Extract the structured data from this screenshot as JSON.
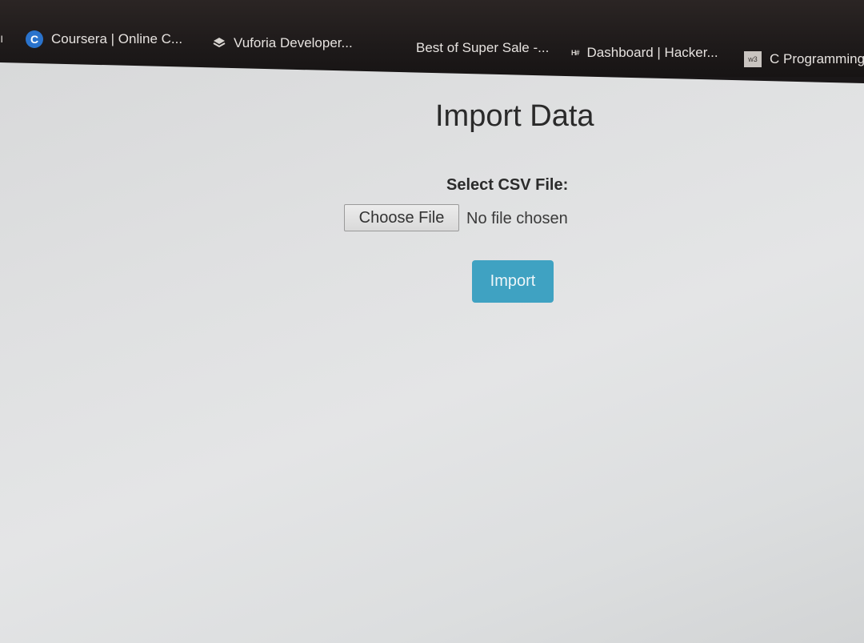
{
  "bookmarks": [
    {
      "icon": "coursera-icon",
      "label": "Coursera | Online C..."
    },
    {
      "icon": "vuforia-icon",
      "label": "Vuforia Developer..."
    },
    {
      "icon": "",
      "label": "Best of Super Sale -..."
    },
    {
      "icon": "hackerrank-icon",
      "label": "Dashboard | Hacker..."
    },
    {
      "icon": "w3schools-icon",
      "label": "C Programming"
    }
  ],
  "bookmark_icon_text": {
    "coursera": "C",
    "hackerrank": "H#",
    "w3schools": "w3"
  },
  "page": {
    "title": "Import Data",
    "file_label": "Select CSV File:",
    "choose_file_label": "Choose File",
    "file_status": "No file chosen",
    "import_label": "Import"
  },
  "colors": {
    "import_button": "#3fa2c2",
    "bookmarks_bar": "#1e1a1a",
    "page_background": "#e0e1e2"
  }
}
